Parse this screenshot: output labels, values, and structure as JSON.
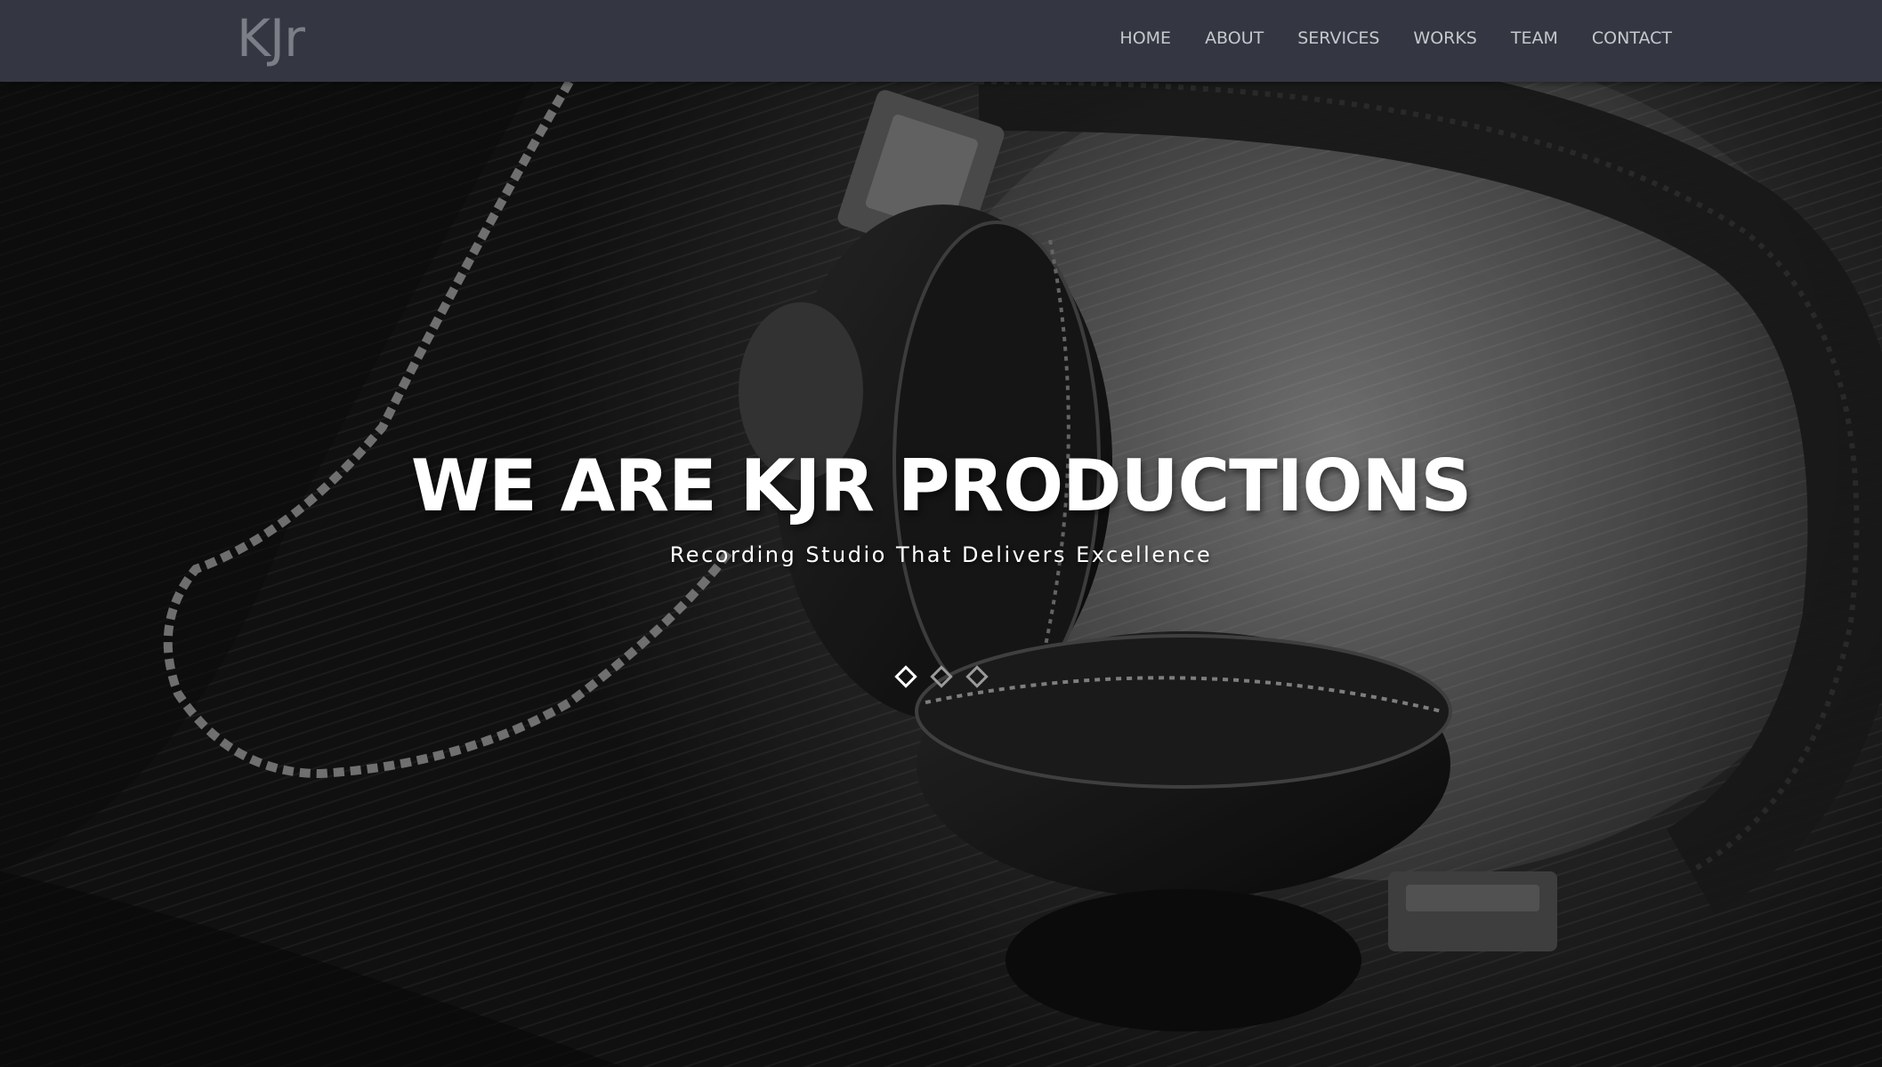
{
  "brand": {
    "logo_text": "KJr"
  },
  "nav": {
    "items": [
      "HOME",
      "ABOUT",
      "SERVICES",
      "WORKS",
      "TEAM",
      "CONTACT"
    ]
  },
  "hero": {
    "title": "WE ARE KJR PRODUCTIONS",
    "subtitle": "Recording Studio That Delivers Excellence",
    "background_image": "headphones on wooden table (black & white photo)"
  },
  "slider": {
    "slide_count": 3,
    "active_index": 0
  },
  "colors": {
    "navbar_bg": "#343741",
    "nav_text": "#c6c8cd",
    "logo_text": "#7b7e86",
    "hero_text": "#ffffff"
  }
}
